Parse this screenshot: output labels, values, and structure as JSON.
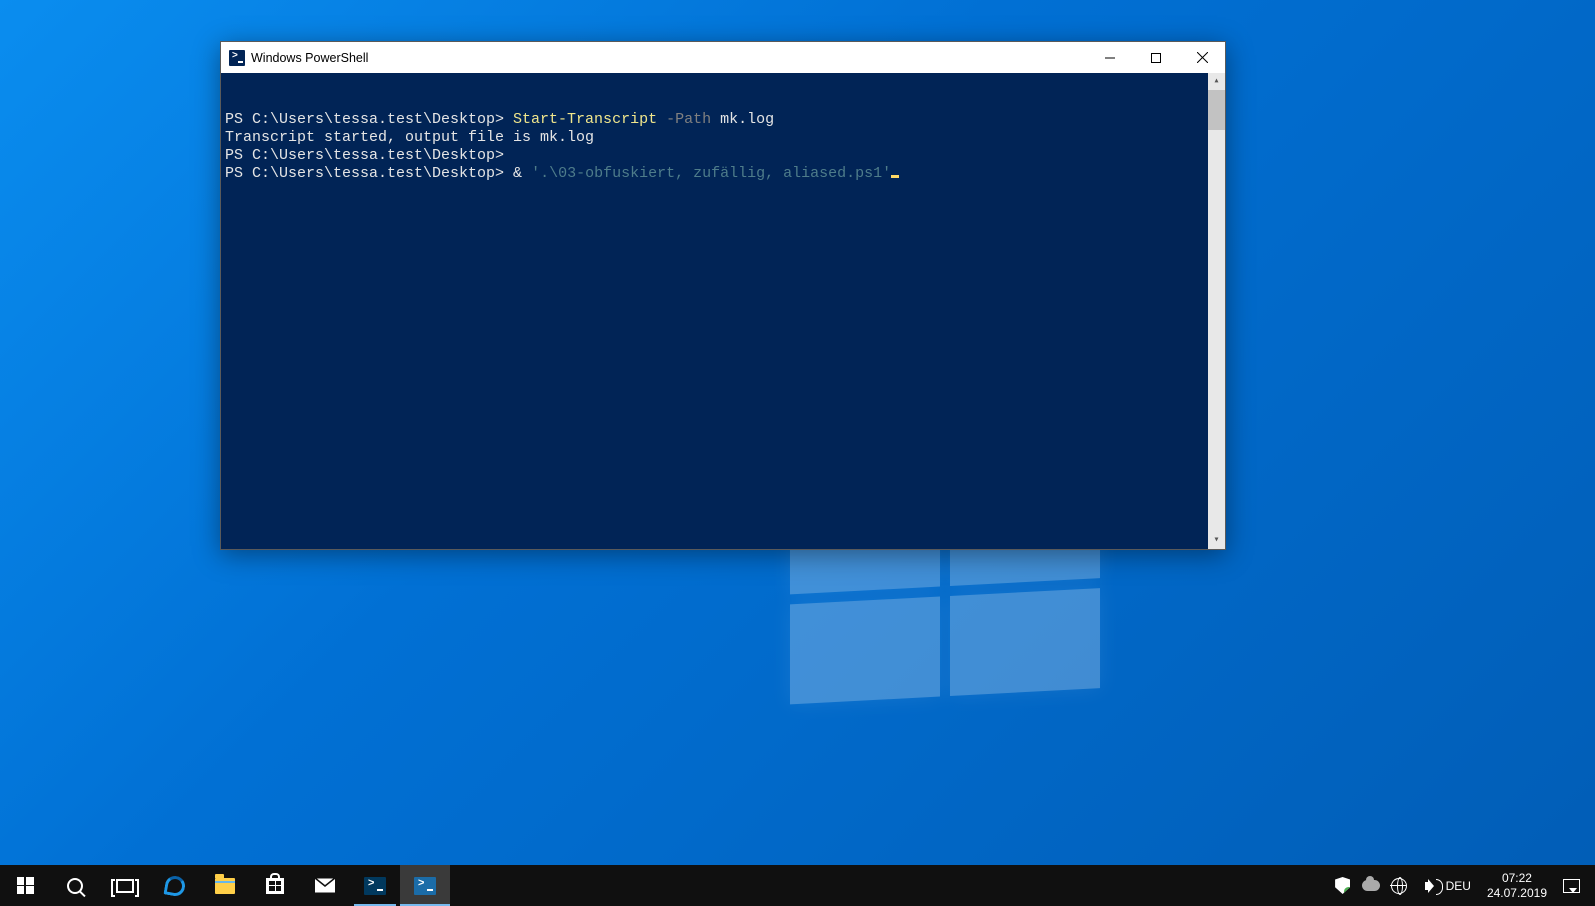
{
  "window": {
    "title": "Windows PowerShell"
  },
  "terminal": {
    "lines": [
      {
        "prompt": "PS C:\\Users\\tessa.test\\Desktop> ",
        "cmd_yellow": "Start-Transcript",
        "cmd_gray": " -Path",
        "cmd_white": " mk.log"
      },
      {
        "plain": "Transcript started, output file is mk.log"
      },
      {
        "prompt": "PS C:\\Users\\tessa.test\\Desktop>",
        "cmd_white": ""
      },
      {
        "prompt": "PS C:\\Users\\tessa.test\\Desktop> ",
        "cmd_white2": "& ",
        "cmd_dcyan": "'.\\03-obfuskiert, zufällig, aliased.ps1'",
        "cursor": true
      }
    ]
  },
  "taskbar": {
    "lang": "DEU",
    "time": "07:22",
    "date": "24.07.2019"
  }
}
